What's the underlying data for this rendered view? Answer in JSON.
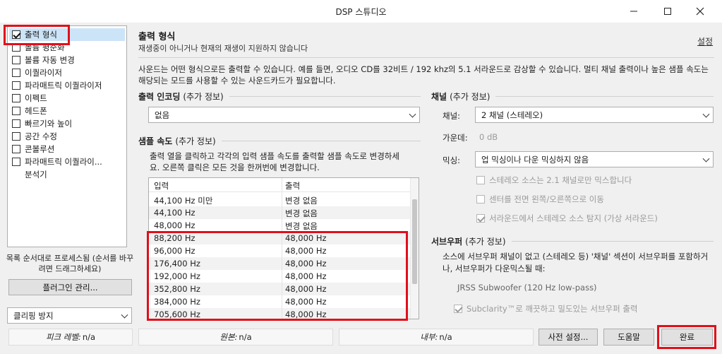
{
  "window": {
    "title": "DSP 스튜디오"
  },
  "sidebar": {
    "items": [
      {
        "label": "출력 형식",
        "checked": true,
        "selected": true
      },
      {
        "label": "볼륨 평준화",
        "checked": false
      },
      {
        "label": "볼륨 자동 변경",
        "checked": false
      },
      {
        "label": "이퀄라이저",
        "checked": false
      },
      {
        "label": "파라매트릭 이퀄라이저",
        "checked": false
      },
      {
        "label": "이펙트",
        "checked": false
      },
      {
        "label": "헤드폰",
        "checked": false
      },
      {
        "label": "빠르기와 높이",
        "checked": false
      },
      {
        "label": "공간 수정",
        "checked": false
      },
      {
        "label": "콘볼루션",
        "checked": false
      },
      {
        "label": "파라매트릭 이퀄라이...",
        "checked": false
      },
      {
        "label": "분석기",
        "checked": null
      }
    ],
    "order_hint": "목록 순서대로 프로세스됨 (순서를 바꾸려면 드래그하세요)",
    "plugin_button": "플러그인 관리...",
    "clipping_select": "클리핑 방지"
  },
  "main": {
    "title": "출력 형식",
    "subtitle": "재생중이 아니거나 현재의 재생이 지원하지 않습니다",
    "settings_link": "설정",
    "description": "사운드는 어떤 형식으로든 출력할 수 있습니다. 예를 들면, 오디오 CD를 32비트 / 192 khz의 5.1 서라운드로 감상할 수 있습니다.  멀티 채널 출력이나 높은 샘플 속도는 해당되는 모드를 사용할 수 있는 사운드카드가 필요합니다.",
    "encoding": {
      "label": "출력 인코딩",
      "info": "(추가 정보)",
      "value": "없음"
    },
    "sample_rate": {
      "label": "샘플 속도",
      "info": "(추가 정보)",
      "help": "출력 열을 클릭하고 각각의 입력 샘플 속도를 출력할 샘플 속도로 변경하세요. 오른쪽 클릭은 모든 것을 한꺼번에 변경합니다.",
      "columns": [
        "입력",
        "출력"
      ],
      "rows": [
        [
          "44,100 Hz 미만",
          "변경 없음"
        ],
        [
          "44,100 Hz",
          "변경 없음"
        ],
        [
          "48,000 Hz",
          "변경 없음"
        ],
        [
          "88,200 Hz",
          "48,000 Hz"
        ],
        [
          "96,000 Hz",
          "48,000 Hz"
        ],
        [
          "176,400 Hz",
          "48,000 Hz"
        ],
        [
          "192,000 Hz",
          "48,000 Hz"
        ],
        [
          "352,800 Hz",
          "48,000 Hz"
        ],
        [
          "384,000 Hz",
          "48,000 Hz"
        ],
        [
          "705,600 Hz",
          "48,000 Hz"
        ]
      ]
    },
    "channel": {
      "label": "채널",
      "info": "(추가 정보)",
      "channel_label": "채널:",
      "channel_value": "2 채널 (스테레오)",
      "center_label": "가운데:",
      "center_value": "0 dB",
      "mix_label": "믹싱:",
      "mix_value": "업 믹싱이나 다운 믹싱하지 않음",
      "opt1": "스테레오 소스는 2.1 채널로만 믹스합니다",
      "opt2": "센터를 전면 왼쪽/오른쪽으로 이동",
      "opt3": "서라운드에서 스테레오 소스 탐지 (가상 서라운드)"
    },
    "subwoofer": {
      "label": "서브우퍼",
      "info": "(추가 정보)",
      "desc": "소스에 서브우퍼 채널이 없고 (스테레오 등) '채널' 섹션이 서브우퍼를 포함하거나, 서브우퍼가 다운믹스될 때:",
      "filter": "JRSS Subwoofer (120 Hz low-pass)",
      "subclarity": "Subclarity™로 깨끗하고 밀도있는 서브우퍼 출력"
    }
  },
  "statusbar": {
    "peak_label": "피크 레벨:",
    "peak_value": "n/a",
    "source_label": "원본:",
    "source_value": "n/a",
    "internal_label": "내부:",
    "internal_value": "n/a",
    "preset_button": "사전 설정...",
    "help_button": "도움말",
    "done_button": "완료"
  }
}
